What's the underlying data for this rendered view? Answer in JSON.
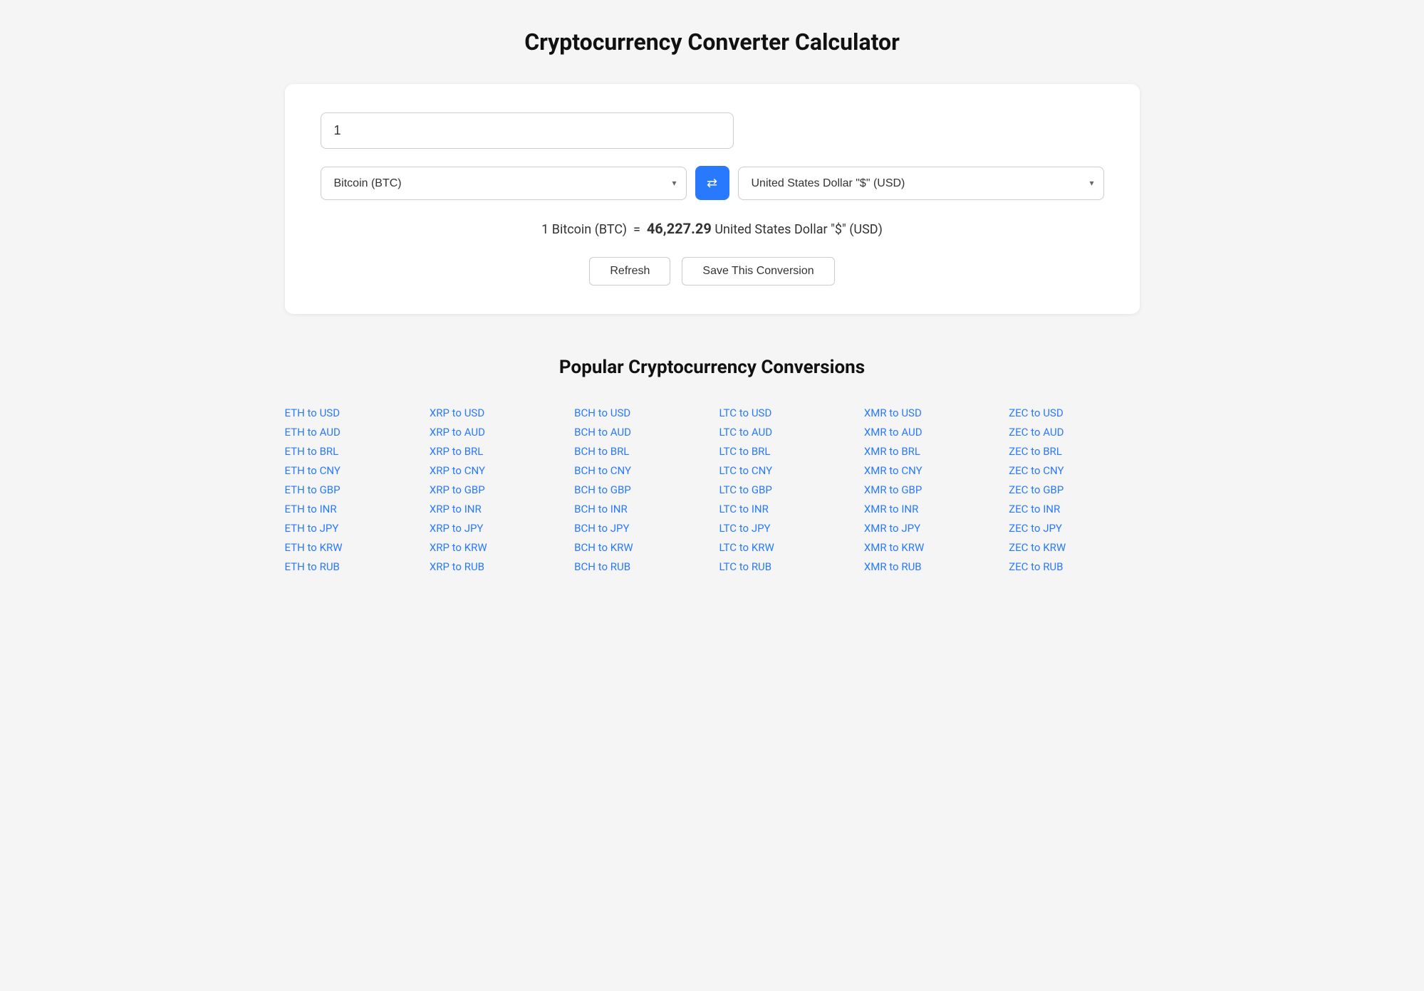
{
  "page": {
    "title": "Cryptocurrency Converter Calculator"
  },
  "converter": {
    "amount_value": "1",
    "from_currency": "Bitcoin (BTC)",
    "to_currency": "United States Dollar \"$\" (USD)",
    "result_text": "1 Bitcoin (BTC)",
    "equals": "=",
    "result_amount": "46,227.29",
    "result_currency": "United States Dollar \"$\" (USD)",
    "swap_icon": "⇄",
    "chevron_down": "▾",
    "refresh_label": "Refresh",
    "save_label": "Save This Conversion"
  },
  "popular": {
    "title": "Popular Cryptocurrency Conversions",
    "columns": [
      {
        "id": "eth",
        "links": [
          "ETH to USD",
          "ETH to AUD",
          "ETH to BRL",
          "ETH to CNY",
          "ETH to GBP",
          "ETH to INR",
          "ETH to JPY",
          "ETH to KRW",
          "ETH to RUB"
        ]
      },
      {
        "id": "xrp",
        "links": [
          "XRP to USD",
          "XRP to AUD",
          "XRP to BRL",
          "XRP to CNY",
          "XRP to GBP",
          "XRP to INR",
          "XRP to JPY",
          "XRP to KRW",
          "XRP to RUB"
        ]
      },
      {
        "id": "bch",
        "links": [
          "BCH to USD",
          "BCH to AUD",
          "BCH to BRL",
          "BCH to CNY",
          "BCH to GBP",
          "BCH to INR",
          "BCH to JPY",
          "BCH to KRW",
          "BCH to RUB"
        ]
      },
      {
        "id": "ltc",
        "links": [
          "LTC to USD",
          "LTC to AUD",
          "LTC to BRL",
          "LTC to CNY",
          "LTC to GBP",
          "LTC to INR",
          "LTC to JPY",
          "LTC to KRW",
          "LTC to RUB"
        ]
      },
      {
        "id": "xmr",
        "links": [
          "XMR to USD",
          "XMR to AUD",
          "XMR to BRL",
          "XMR to CNY",
          "XMR to GBP",
          "XMR to INR",
          "XMR to JPY",
          "XMR to KRW",
          "XMR to RUB"
        ]
      },
      {
        "id": "zec",
        "links": [
          "ZEC to USD",
          "ZEC to AUD",
          "ZEC to BRL",
          "ZEC to CNY",
          "ZEC to GBP",
          "ZEC to INR",
          "ZEC to JPY",
          "ZEC to KRW",
          "ZEC to RUB"
        ]
      }
    ]
  }
}
